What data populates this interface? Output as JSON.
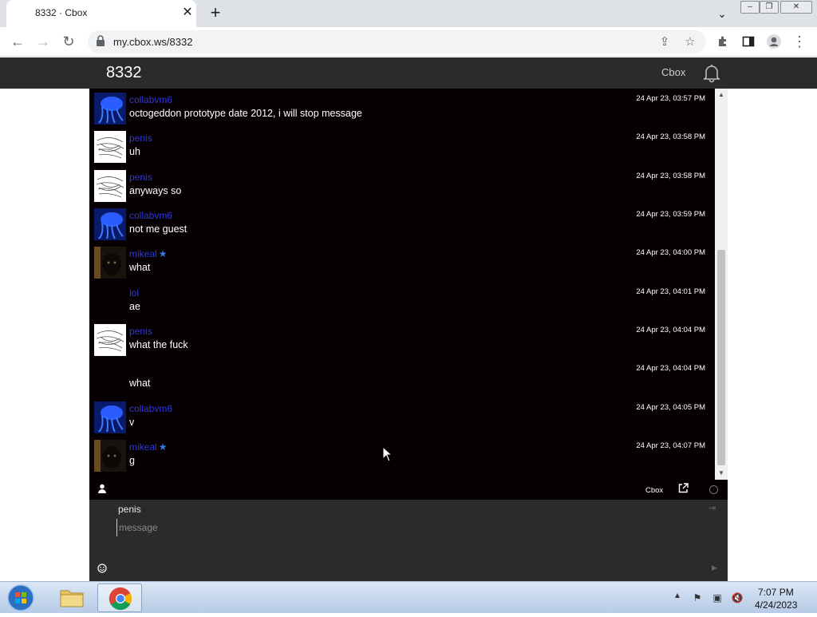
{
  "browser": {
    "tab_title": "8332 · Cbox",
    "url": "my.cbox.ws/8332"
  },
  "cbox": {
    "title": "8332",
    "brand": "Cbox"
  },
  "messages": [
    {
      "user": "collabvm6",
      "star": false,
      "text": "octogeddon prototype date 2012, i will stop message",
      "time": "24 Apr 23, 03:57 PM",
      "avatar": "jellyfish"
    },
    {
      "user": "penis",
      "star": false,
      "text": "uh",
      "time": "24 Apr 23, 03:58 PM",
      "avatar": "scribble"
    },
    {
      "user": "penis",
      "star": false,
      "text": "anyways so",
      "time": "24 Apr 23, 03:58 PM",
      "avatar": "scribble"
    },
    {
      "user": "collabvm6",
      "star": false,
      "text": "not me guest",
      "time": "24 Apr 23, 03:59 PM",
      "avatar": "jellyfish"
    },
    {
      "user": "mikeal",
      "star": true,
      "text": "what",
      "time": "24 Apr 23, 04:00 PM",
      "avatar": "cat"
    },
    {
      "user": "lol",
      "star": false,
      "text": "ae",
      "time": "24 Apr 23, 04:01 PM",
      "avatar": "none"
    },
    {
      "user": "penis",
      "star": false,
      "text": "what the fuck",
      "time": "24 Apr 23, 04:04 PM",
      "avatar": "scribble"
    },
    {
      "user": "",
      "star": false,
      "text": "what",
      "time": "24 Apr 23, 04:04 PM",
      "avatar": "none"
    },
    {
      "user": "collabvm6",
      "star": false,
      "text": "v",
      "time": "24 Apr 23, 04:05 PM",
      "avatar": "jellyfish"
    },
    {
      "user": "mikeal",
      "star": true,
      "text": "g",
      "time": "24 Apr 23, 04:07 PM",
      "avatar": "cat"
    }
  ],
  "chat_bar": {
    "brand": "Cbox"
  },
  "compose": {
    "name": "penis",
    "placeholder": "message"
  },
  "taskbar": {
    "time": "7:07 PM",
    "date": "4/24/2023"
  },
  "icons": {
    "back": "back-arrow-icon",
    "forward": "forward-arrow-icon",
    "reload": "reload-icon",
    "lock": "lock-icon",
    "share": "share-icon",
    "bookmark": "star-icon",
    "extensions": "puzzle-icon",
    "sidepanel": "side-panel-icon",
    "profile": "profile-icon",
    "menu": "kebab-menu-icon",
    "bell": "bell-icon",
    "user": "user-icon",
    "popout": "popout-icon",
    "emoji": "smiley-icon"
  }
}
